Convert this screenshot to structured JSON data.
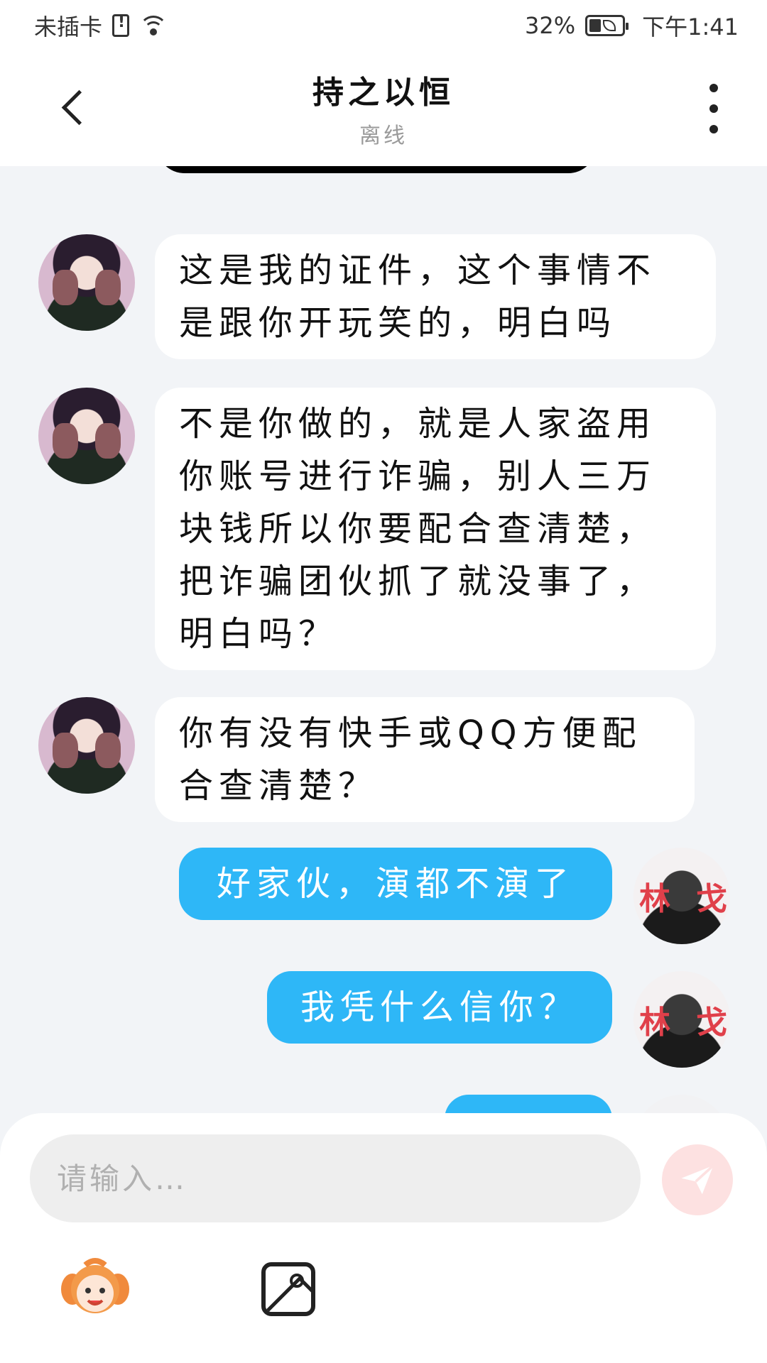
{
  "status_bar": {
    "carrier": "未插卡",
    "battery": "32%",
    "time": "下午1:41"
  },
  "header": {
    "title": "持之以恒",
    "subtitle": "离线"
  },
  "messages": [
    {
      "side": "in",
      "text": "这是我的证件，这个事情不是跟你开玩笑的，明白吗"
    },
    {
      "side": "in",
      "text": "不是你做的，就是人家盗用你账号进行诈骗，别人三万块钱所以你要配合查清楚，把诈骗团伙抓了就没事了，明白吗？"
    },
    {
      "side": "in",
      "text": "你有没有快手或QQ方便配合查清楚？"
    },
    {
      "side": "out",
      "text": "好家伙，演都不演了"
    },
    {
      "side": "out",
      "text": "我凭什么信你？"
    }
  ],
  "avatar_right_mark": {
    "left": "林",
    "right": "戈"
  },
  "input": {
    "placeholder": "请输入…",
    "value": ""
  },
  "icons": {
    "send": "send-icon",
    "emoji": "emoji-mascot-icon",
    "image": "image-icon",
    "back": "back-icon",
    "more": "more-vertical-icon"
  },
  "colors": {
    "outgoing_bubble": "#2eb7f7",
    "incoming_bubble": "#ffffff",
    "chat_background": "#f2f4f7",
    "send_button": "#fde1e1"
  }
}
